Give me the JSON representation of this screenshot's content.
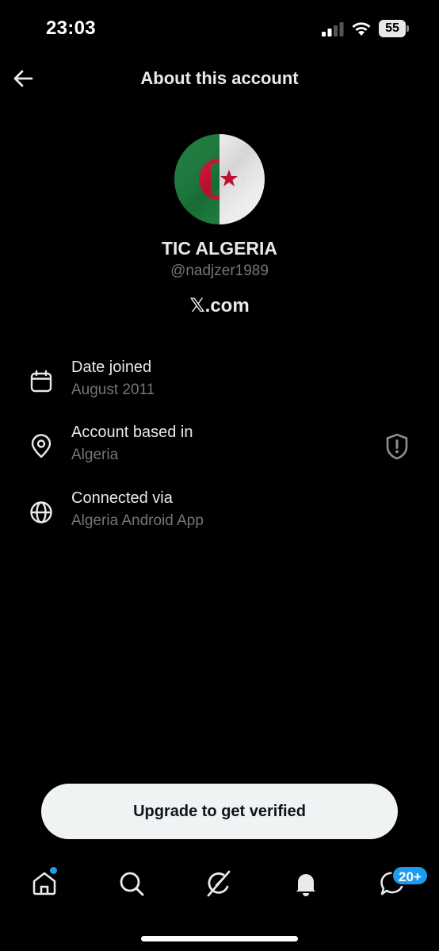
{
  "status_bar": {
    "time": "23:03",
    "battery_level": "55",
    "icons": [
      "signal-icon",
      "wifi-icon",
      "battery-icon"
    ]
  },
  "header": {
    "title": "About this account",
    "back_icon": "arrow-left-icon"
  },
  "profile": {
    "display_name": "TIC ALGERIA",
    "handle": "@nadjzer1989",
    "site_glyph": "𝕏",
    "site_suffix": ".com",
    "avatar": "algeria-flag-avatar"
  },
  "info_rows": [
    {
      "icon": "calendar-icon",
      "title": "Date joined",
      "value": "August 2011"
    },
    {
      "icon": "location-pin-icon",
      "title": "Account based in",
      "value": "Algeria",
      "trailing_icon": "shield-icon"
    },
    {
      "icon": "globe-icon",
      "title": "Connected via",
      "value": "Algeria Android App"
    }
  ],
  "upgrade_button": {
    "label": "Upgrade to get verified"
  },
  "tab_bar": {
    "tabs": [
      "home-icon",
      "search-icon",
      "grok-icon",
      "notifications-icon",
      "messages-icon"
    ],
    "messages_badge": "20+"
  },
  "colors": {
    "background": "#000000",
    "primary_text": "#e7e9ea",
    "secondary_text": "#71767b",
    "accent": "#1d9bf0",
    "button_bg": "#eff3f4",
    "flag_green": "#1a7a3c",
    "flag_red": "#d21034"
  }
}
